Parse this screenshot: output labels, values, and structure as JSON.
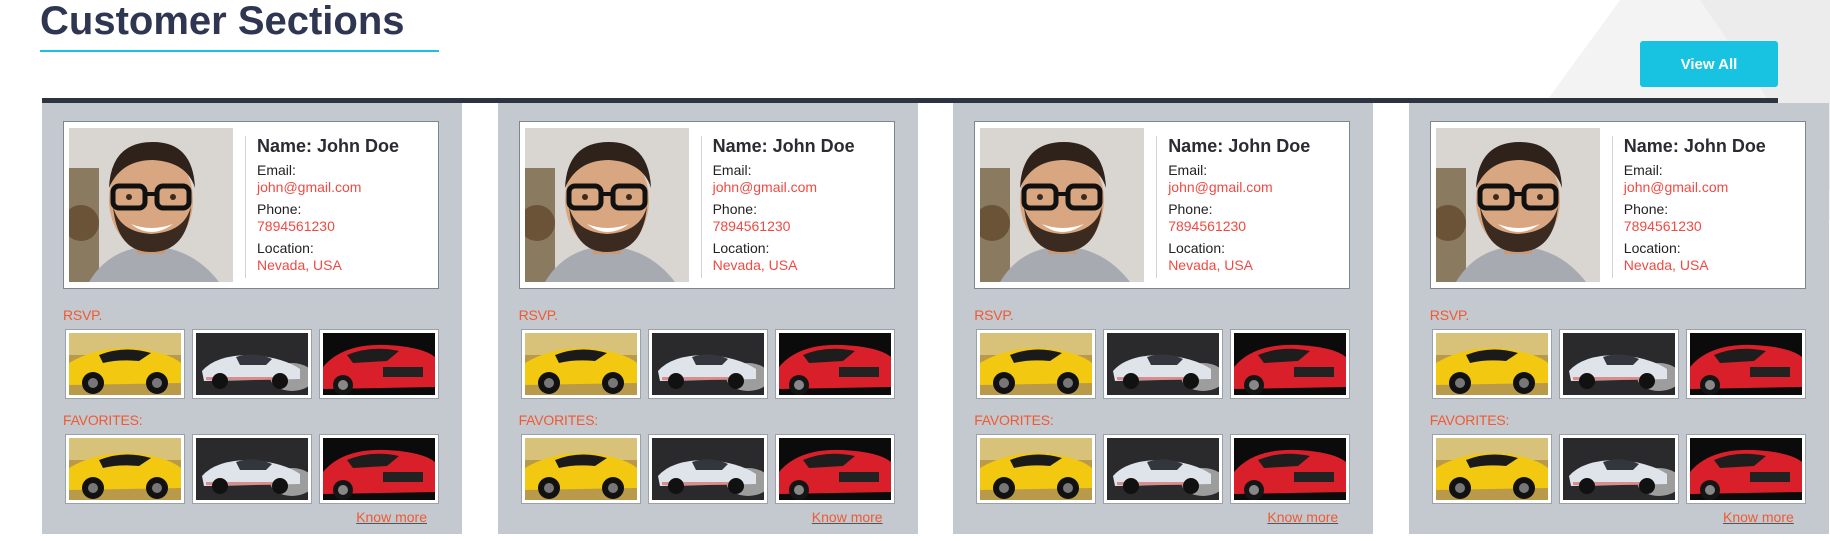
{
  "page": {
    "title": "Customer Sections",
    "view_all_label": "View All"
  },
  "colors": {
    "accent": "#17c3e1",
    "title": "#2f3651",
    "value_red": "#ef4a43",
    "section_orange": "#ef5a33",
    "card_bg": "#c3c9cf",
    "panel_border": "#2d3340"
  },
  "cards": [
    {
      "name": "Name: John Doe",
      "email_label": "Email:",
      "email": "john@gmail.com",
      "phone_label": "Phone:",
      "phone": "7894561230",
      "location_label": "Location:",
      "location": "Nevada, USA",
      "rsvp_label": "RSVP.",
      "favorites_label": "FAVORITES:",
      "know_more": "Know more",
      "rsvp_images": [
        "yellow-sports-car",
        "silver-sports-car",
        "red-sports-car"
      ],
      "favorite_images": [
        "yellow-sports-car",
        "silver-sports-car",
        "red-sports-car"
      ]
    },
    {
      "name": "Name: John Doe",
      "email_label": "Email:",
      "email": "john@gmail.com",
      "phone_label": "Phone:",
      "phone": "7894561230",
      "location_label": "Location:",
      "location": "Nevada, USA",
      "rsvp_label": "RSVP.",
      "favorites_label": "FAVORITES:",
      "know_more": "Know more",
      "rsvp_images": [
        "yellow-sports-car",
        "silver-sports-car",
        "red-sports-car"
      ],
      "favorite_images": [
        "yellow-sports-car",
        "silver-sports-car",
        "red-sports-car"
      ]
    },
    {
      "name": "Name: John Doe",
      "email_label": "Email:",
      "email": "john@gmail.com",
      "phone_label": "Phone:",
      "phone": "7894561230",
      "location_label": "Location:",
      "location": "Nevada, USA",
      "rsvp_label": "RSVP.",
      "favorites_label": "FAVORITES:",
      "know_more": "Know more",
      "rsvp_images": [
        "yellow-sports-car",
        "silver-sports-car",
        "red-sports-car"
      ],
      "favorite_images": [
        "yellow-sports-car",
        "silver-sports-car",
        "red-sports-car"
      ]
    },
    {
      "name": "Name: John Doe",
      "email_label": "Email:",
      "email": "john@gmail.com",
      "phone_label": "Phone:",
      "phone": "7894561230",
      "location_label": "Location:",
      "location": "Nevada, USA",
      "rsvp_label": "RSVP.",
      "favorites_label": "FAVORITES:",
      "know_more": "Know more",
      "rsvp_images": [
        "yellow-sports-car",
        "silver-sports-car",
        "red-sports-car"
      ],
      "favorite_images": [
        "yellow-sports-car",
        "silver-sports-car",
        "red-sports-car"
      ]
    }
  ]
}
